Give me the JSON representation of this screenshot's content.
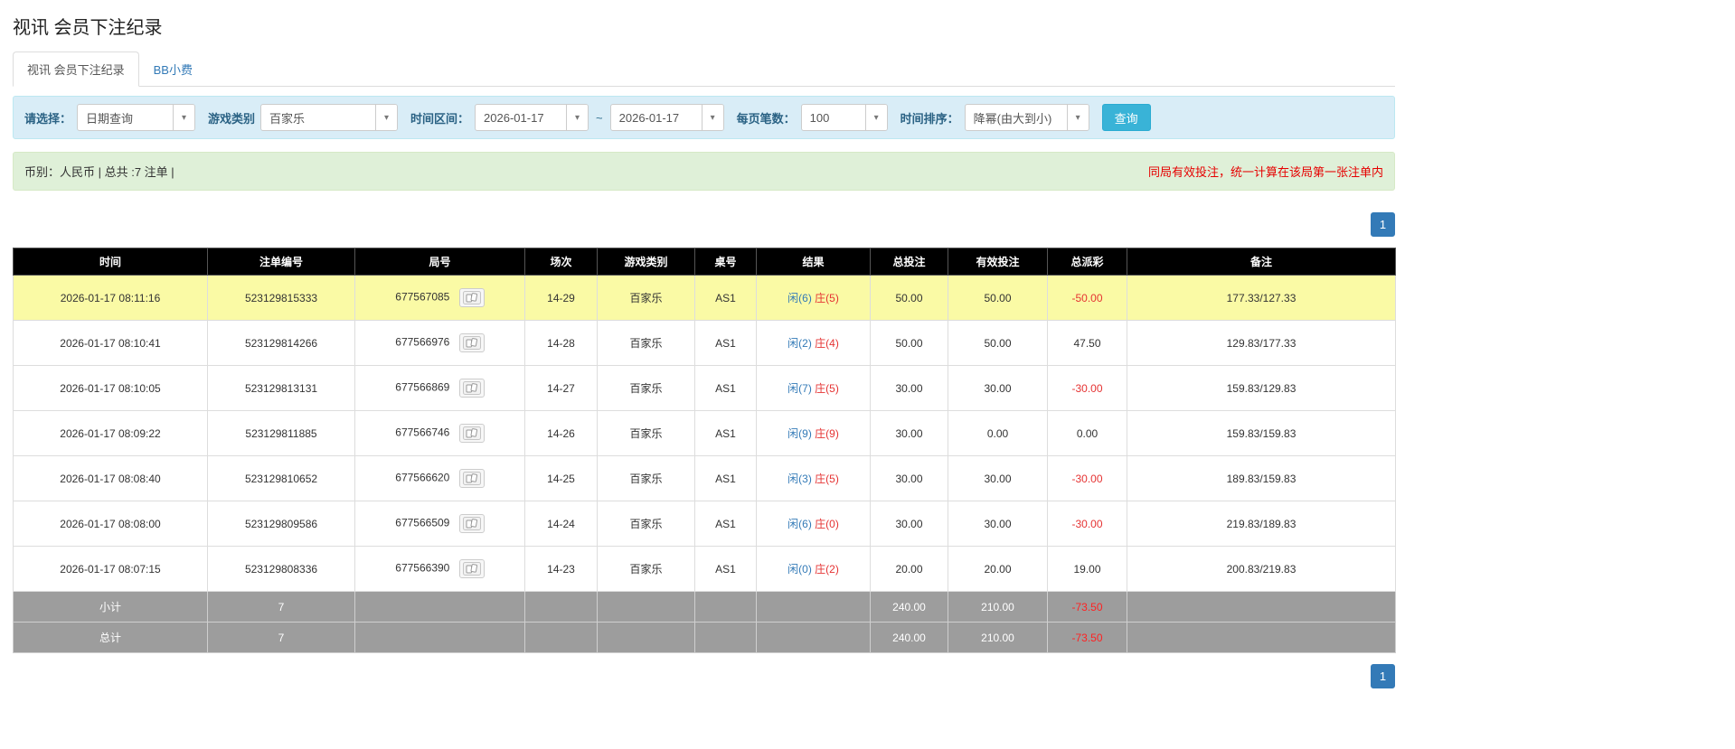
{
  "page": {
    "title": "视讯 会员下注纪录"
  },
  "tabs": [
    {
      "label": "视讯 会员下注纪录"
    },
    {
      "label": "BB小费"
    }
  ],
  "filters": {
    "select_label": "请选择：",
    "select_value": "日期查询",
    "game_type_label": "游戏类别",
    "game_type_value": "百家乐",
    "range_label": "时间区间：",
    "date_from": "2026-01-17",
    "range_separator": "~",
    "date_to": "2026-01-17",
    "page_size_label": "每页笔数：",
    "page_size_value": "100",
    "sort_label": "时间排序：",
    "sort_value": "降幂(由大到小)",
    "query_button": "查询"
  },
  "info_bar": {
    "summary": "币别：人民币 | 总共 :7 注单 |",
    "notice": "同局有效投注，统一计算在该局第一张注单内"
  },
  "pagination": {
    "current_page": "1"
  },
  "table": {
    "headers": [
      "时间",
      "注单编号",
      "局号",
      "场次",
      "游戏类别",
      "桌号",
      "结果",
      "总投注",
      "有效投注",
      "总派彩",
      "备注"
    ],
    "rows": [
      {
        "time": "2026-01-17 08:11:16",
        "bet_id": "523129815333",
        "round_id": "677567085",
        "session": "14-29",
        "game": "百家乐",
        "table_no": "AS1",
        "result_player": "闲(6)",
        "result_banker": "庄(5)",
        "total_bet": "50.00",
        "valid_bet": "50.00",
        "payout": "-50.00",
        "note": "177.33/127.33",
        "highlight": true
      },
      {
        "time": "2026-01-17 08:10:41",
        "bet_id": "523129814266",
        "round_id": "677566976",
        "session": "14-28",
        "game": "百家乐",
        "table_no": "AS1",
        "result_player": "闲(2)",
        "result_banker": "庄(4)",
        "total_bet": "50.00",
        "valid_bet": "50.00",
        "payout": "47.50",
        "note": "129.83/177.33",
        "highlight": false
      },
      {
        "time": "2026-01-17 08:10:05",
        "bet_id": "523129813131",
        "round_id": "677566869",
        "session": "14-27",
        "game": "百家乐",
        "table_no": "AS1",
        "result_player": "闲(7)",
        "result_banker": "庄(5)",
        "total_bet": "30.00",
        "valid_bet": "30.00",
        "payout": "-30.00",
        "note": "159.83/129.83",
        "highlight": false
      },
      {
        "time": "2026-01-17 08:09:22",
        "bet_id": "523129811885",
        "round_id": "677566746",
        "session": "14-26",
        "game": "百家乐",
        "table_no": "AS1",
        "result_player": "闲(9)",
        "result_banker": "庄(9)",
        "total_bet": "30.00",
        "valid_bet": "0.00",
        "payout": "0.00",
        "note": "159.83/159.83",
        "highlight": false
      },
      {
        "time": "2026-01-17 08:08:40",
        "bet_id": "523129810652",
        "round_id": "677566620",
        "session": "14-25",
        "game": "百家乐",
        "table_no": "AS1",
        "result_player": "闲(3)",
        "result_banker": "庄(5)",
        "total_bet": "30.00",
        "valid_bet": "30.00",
        "payout": "-30.00",
        "note": "189.83/159.83",
        "highlight": false
      },
      {
        "time": "2026-01-17 08:08:00",
        "bet_id": "523129809586",
        "round_id": "677566509",
        "session": "14-24",
        "game": "百家乐",
        "table_no": "AS1",
        "result_player": "闲(6)",
        "result_banker": "庄(0)",
        "total_bet": "30.00",
        "valid_bet": "30.00",
        "payout": "-30.00",
        "note": "219.83/189.83",
        "highlight": false
      },
      {
        "time": "2026-01-17 08:07:15",
        "bet_id": "523129808336",
        "round_id": "677566390",
        "session": "14-23",
        "game": "百家乐",
        "table_no": "AS1",
        "result_player": "闲(0)",
        "result_banker": "庄(2)",
        "total_bet": "20.00",
        "valid_bet": "20.00",
        "payout": "19.00",
        "note": "200.83/219.83",
        "highlight": false
      }
    ],
    "subtotal": {
      "label": "小计",
      "count": "7",
      "total_bet": "240.00",
      "valid_bet": "210.00",
      "payout": "-73.50"
    },
    "total": {
      "label": "总计",
      "count": "7",
      "total_bet": "240.00",
      "valid_bet": "210.00",
      "payout": "-73.50"
    }
  },
  "colors": {
    "accent_blue": "#337ab7",
    "query_button_blue": "#39b3d7",
    "filter_bar_bg": "#d9edf7",
    "info_bar_bg": "#dff0d8",
    "highlight_row_yellow": "#fafaa5",
    "negative_red": "#e53333",
    "notice_red": "#e60000",
    "table_header_bg": "#000000",
    "summary_row_bg": "#9d9d9d"
  }
}
